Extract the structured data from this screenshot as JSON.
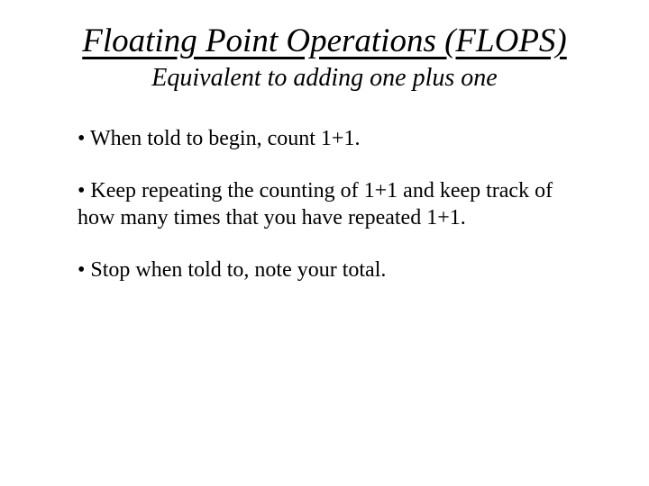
{
  "title": "Floating Point Operations (FLOPS)",
  "subtitle": "Equivalent to adding one plus one",
  "bullets": [
    "• When told to begin, count 1+1.",
    "• Keep repeating the counting of 1+1 and keep track of how many times that you have repeated 1+1.",
    "• Stop when told to, note your total."
  ]
}
